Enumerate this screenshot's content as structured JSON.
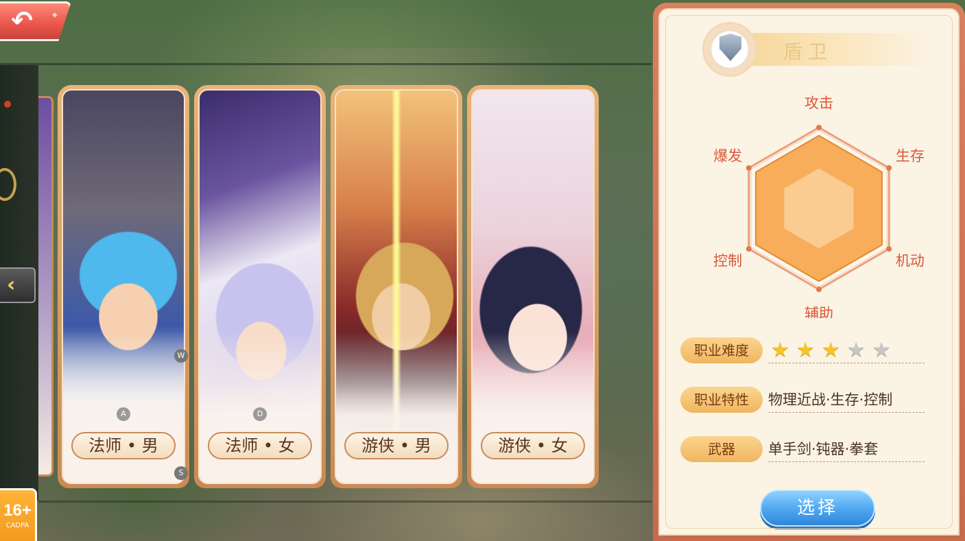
{
  "top_bar": {
    "back_icon": "back-arrow-icon"
  },
  "carousel": {
    "cards": [
      {
        "label": "法师 • 男",
        "key": "A",
        "art": "mage-male"
      },
      {
        "label": "法师 • 女",
        "key": "D",
        "art": "mage-female"
      },
      {
        "label": "游侠 • 男",
        "key": "",
        "art": "ranger-male"
      },
      {
        "label": "游侠 • 女",
        "key": "",
        "art": "ranger-female"
      }
    ],
    "hint_keys": {
      "w": "W",
      "s": "S"
    }
  },
  "info_panel": {
    "class_name": "盾卫",
    "class_icon": "shield-icon",
    "radar": {
      "axes": [
        "攻击",
        "生存",
        "机动",
        "辅助",
        "控制",
        "爆发"
      ],
      "values": [
        0.9,
        0.9,
        0.9,
        0.9,
        0.9,
        0.9
      ],
      "max": 1
    },
    "difficulty": {
      "label": "职业难度",
      "stars_filled": 3,
      "stars_total": 5
    },
    "traits": {
      "label": "职业特性",
      "value": "物理近战·生存·控制"
    },
    "weapon": {
      "label": "武器",
      "value": "单手剑·钝器·拳套"
    },
    "select_button": "选择"
  },
  "age_rating": {
    "age": "16+",
    "org": "CADPA"
  },
  "colors": {
    "accent_orange": "#f0b560",
    "radar_fill": "#f6a54a",
    "label_red": "#d9583a",
    "select_blue": "#4ea6f0"
  }
}
